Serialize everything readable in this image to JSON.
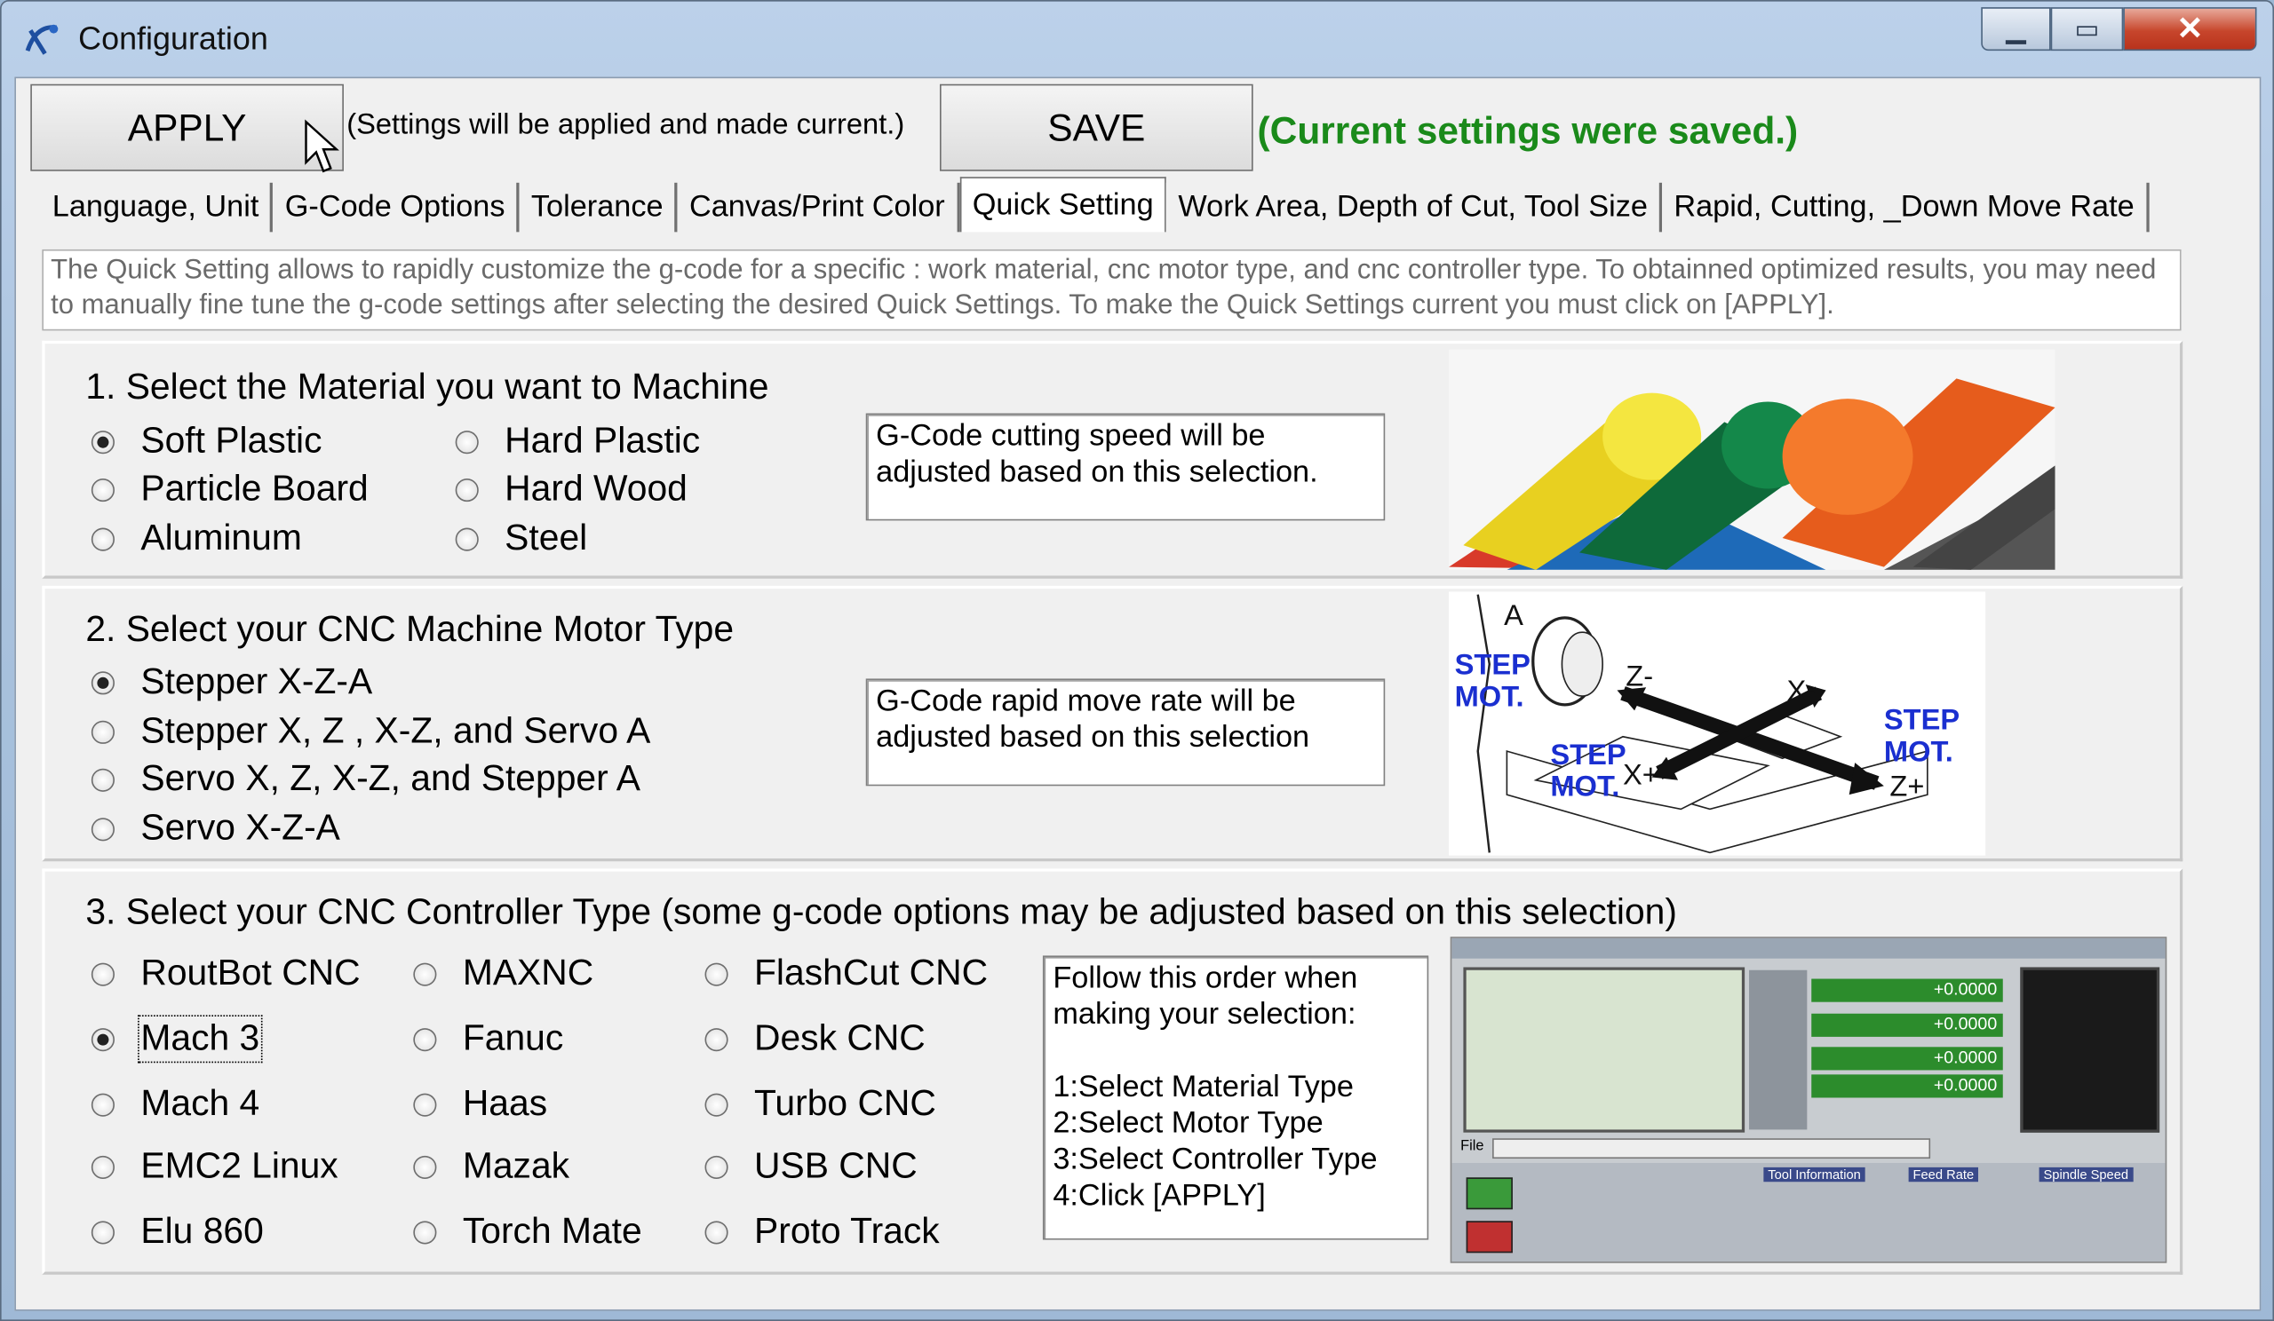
{
  "window": {
    "title": "Configuration",
    "min_glyph": "▁",
    "max_glyph": "▭",
    "close_glyph": "✕"
  },
  "toolbar": {
    "apply_label": "APPLY",
    "apply_note": "(Settings will be applied and made current.)",
    "save_label": "SAVE",
    "save_status": "(Current settings were saved.)",
    "status_color": "#1a8a1a"
  },
  "tabs": [
    {
      "label": "Language, Unit",
      "active": false
    },
    {
      "label": "G-Code Options",
      "active": false
    },
    {
      "label": "Tolerance",
      "active": false
    },
    {
      "label": "Canvas/Print Color",
      "active": false
    },
    {
      "label": "Quick Setting",
      "active": true
    },
    {
      "label": "Work Area, Depth of Cut, Tool Size",
      "active": false
    },
    {
      "label": "Rapid, Cutting, _Down Move Rate",
      "active": false
    }
  ],
  "description": "The Quick Setting allows to rapidly customize the g-code for a specific : work material, cnc motor type, and cnc controller type. To obtainned optimized results, you may need to manually  fine tune the g-code settings after selecting the desired Quick Settings. To make the Quick Settings current you must click on [APPLY].",
  "material": {
    "heading": "1. Select the Material you want  to Machine",
    "options": [
      "Soft Plastic",
      "Hard Plastic",
      "Particle Board",
      "Hard Wood",
      "Aluminum",
      "Steel"
    ],
    "selected": "Soft Plastic",
    "info": "G-Code cutting speed will be\nadjusted based on this selection."
  },
  "motor": {
    "heading": "2. Select your CNC Machine Motor Type",
    "options": [
      "Stepper X-Z-A",
      "Stepper X, Z , X-Z, and Servo A",
      "Servo X, Z, X-Z, and Stepper A",
      "Servo X-Z-A"
    ],
    "selected": "Stepper X-Z-A",
    "info": "G-Code rapid move rate will be\nadjusted based on this selection",
    "diagram": {
      "step_mot": "STEP\nMOT.",
      "axis_a": "A",
      "axis_zm": "Z-",
      "axis_xm": "X-",
      "axis_xp": "X+",
      "axis_zp": "Z+"
    }
  },
  "controller": {
    "heading": "3. Select your CNC Controller Type (some g-code options may be adjusted based on this selection)",
    "options": [
      "RoutBot CNC",
      "MAXNC",
      "FlashCut CNC",
      "Mach 3",
      "Fanuc",
      "Desk CNC",
      "Mach 4",
      "Haas",
      "Turbo CNC",
      "EMC2 Linux",
      "Mazak",
      "USB CNC",
      "Elu 860",
      "Torch Mate",
      "Proto Track"
    ],
    "selected": "Mach 3",
    "info": "Follow this order when\nmaking your selection:\n\n1:Select Material Type\n2:Select Motor Type\n3:Select Controller Type\n4:Click [APPLY]",
    "dro_values": [
      "+0.0000",
      "+0.0000",
      "+0.0000",
      "+0.0000"
    ],
    "screenshot_labels": {
      "tool": "Tool Information",
      "feed": "Feed Rate",
      "spindle": "Spindle Speed",
      "file": "File"
    }
  }
}
